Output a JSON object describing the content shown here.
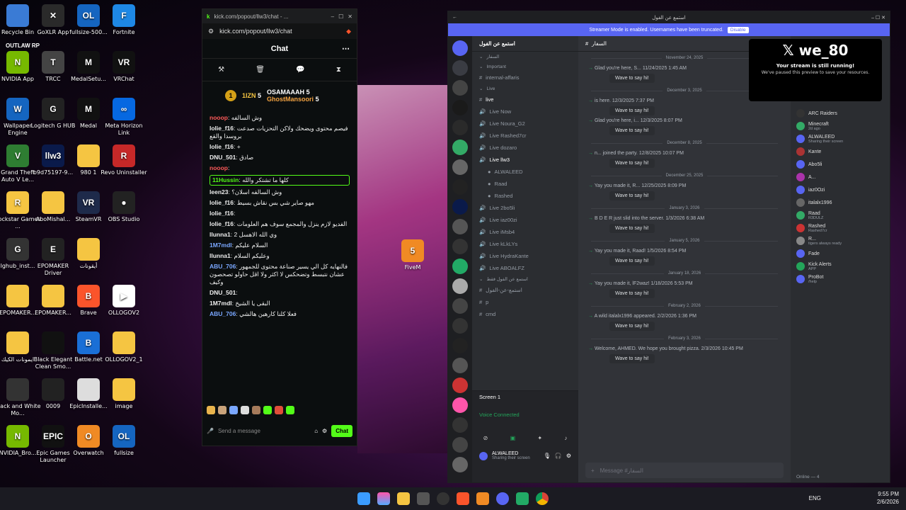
{
  "desktop": {
    "icons": [
      {
        "label": "Recycle Bin",
        "badge": ""
      },
      {
        "label": "GoXLR App",
        "badge": "✕"
      },
      {
        "label": "fullsize-500...",
        "badge": "OL"
      },
      {
        "label": "Fortnite",
        "badge": "F"
      },
      {
        "label": "NVIDIA App",
        "badge": "N"
      },
      {
        "label": "TRCC",
        "badge": "T"
      },
      {
        "label": "MedalSetu...",
        "badge": "M"
      },
      {
        "label": "VRChat",
        "badge": "VR"
      },
      {
        "label": "Wallpaper Engine",
        "badge": "W"
      },
      {
        "label": "Logitech G HUB",
        "badge": "G"
      },
      {
        "label": "Medal",
        "badge": "M"
      },
      {
        "label": "Meta Horizon Link",
        "badge": "∞"
      },
      {
        "label": "Grand Theft Auto V Le...",
        "badge": "V"
      },
      {
        "label": "b9d75197-9...",
        "badge": "llw3"
      },
      {
        "label": "980 1",
        "badge": ""
      },
      {
        "label": "Revo Uninstaller",
        "badge": "R"
      },
      {
        "label": "Rockstar Games ...",
        "badge": "R"
      },
      {
        "label": "AboMishal...",
        "badge": ""
      },
      {
        "label": "SteamVR",
        "badge": "VR"
      },
      {
        "label": "OBS Studio",
        "badge": "●"
      },
      {
        "label": "lghub_inst...",
        "badge": "G"
      },
      {
        "label": "EPOMAKER Driver",
        "badge": "E"
      },
      {
        "label": "أيقونات",
        "badge": ""
      },
      {
        "label": "EPOMAKER...",
        "badge": ""
      },
      {
        "label": "EPOMAKER...",
        "badge": ""
      },
      {
        "label": "Brave",
        "badge": "B"
      },
      {
        "label": "OLLOGOV2",
        "badge": "▶"
      },
      {
        "label": "ايمونات الكيك",
        "badge": ""
      },
      {
        "label": "Black Elegant Clean Smo...",
        "badge": ""
      },
      {
        "label": "Battle.net",
        "badge": "B"
      },
      {
        "label": "OLLOGOV2_1",
        "badge": ""
      },
      {
        "label": "Black and White Mo...",
        "badge": ""
      },
      {
        "label": "0009",
        "badge": ""
      },
      {
        "label": "EpicInstalle...",
        "badge": ""
      },
      {
        "label": "image",
        "badge": ""
      },
      {
        "label": "NVIDIA_Bro...",
        "badge": "N"
      },
      {
        "label": "Epic Games Launcher",
        "badge": "EPIC"
      },
      {
        "label": "Overwatch",
        "badge": "O"
      },
      {
        "label": "fullsize",
        "badge": "OL"
      },
      {
        "label": "FiveM",
        "badge": "5"
      }
    ],
    "outlaw_label": "OUTLAW RP"
  },
  "kick": {
    "title": "kick.com/popout/llw3/chat - ...",
    "url": "kick.com/popout/llw3/chat",
    "header": "Chat",
    "board": {
      "rank": "1",
      "n1": "1IZN",
      "p1": "5",
      "n2": "OSAMAAAH",
      "p2": "5",
      "n3": "GhostMansoori",
      "p3": "5"
    },
    "messages": [
      {
        "user": "nooop",
        "text": "وش السالفه",
        "color": "#ff5a5a"
      },
      {
        "user": "lolie_f16",
        "text": "فيصم محتوى ويضحك ولاكن التحزيات صدعت بروسدا والقع",
        "color": "#eee"
      },
      {
        "user": "lolie_f16",
        "text": "+",
        "color": "#eee"
      },
      {
        "user": "DNU_501",
        "text": "صادق",
        "color": "#eee"
      },
      {
        "user": "nooop",
        "text": "",
        "color": "#ff5a5a"
      },
      {
        "user": "11Hussin",
        "text": "كلها ما تشتكر والله",
        "color": "#53fc18"
      },
      {
        "user": "leen23",
        "text": "وش السالفه اسلان؟",
        "color": "#eee"
      },
      {
        "user": "lolie_f16",
        "text": "مهو صاير شي بس نقاش بسيط",
        "color": "#eee"
      },
      {
        "user": "lolie_f16",
        "text": "",
        "color": "#eee"
      },
      {
        "user": "lolie_f16",
        "text": "الفديو لازم ينزل والمجمع سوف هم العلومات",
        "color": "#eee"
      },
      {
        "user": "llunna1",
        "text": "وي الله الاهسل 2",
        "color": "#eee"
      },
      {
        "user": "1M7mdl",
        "text": "السلام عليكم",
        "color": "#7aa7ff"
      },
      {
        "user": "llunna1",
        "text": "وعليكم السلام",
        "color": "#eee"
      },
      {
        "user": "ABU_706",
        "text": "فالنهايه كل الي يسير صناعة محتوى للجمهور عشان نتبسط وتضحكس لا اكثر ولا اقل حاولو تصحصون وكيف",
        "color": "#7aa7ff"
      },
      {
        "user": "DNU_501",
        "text": "",
        "color": "#eee"
      },
      {
        "user": "1M7mdl",
        "text": "البقى يا الشيخ",
        "color": "#eee"
      },
      {
        "user": "ABU_706",
        "text": "فعلا كلنا كارهين هالشي",
        "color": "#7aa7ff"
      }
    ],
    "input_placeholder": "Send a message",
    "chat_button": "Chat"
  },
  "discord": {
    "title": "استمع عن الفول",
    "banner": "Streamer Mode is enabled. Usernames have been truncated.",
    "disable": "Disable",
    "server_name": "استمع عن الفول",
    "channel_header": "السفار",
    "channels": [
      {
        "name": "السفار",
        "type": "cat"
      },
      {
        "name": "Important",
        "type": "cat"
      },
      {
        "name": "internal-affaris",
        "type": "text"
      },
      {
        "name": "Live",
        "type": "cat"
      },
      {
        "name": "live",
        "type": "text"
      },
      {
        "name": "Live Now",
        "type": "voice"
      },
      {
        "name": "Live Noura_G2",
        "type": "voice"
      },
      {
        "name": "Live Rashed7cr",
        "type": "voice"
      },
      {
        "name": "Live dozaro",
        "type": "voice"
      },
      {
        "name": "Live llw3",
        "type": "voice"
      },
      {
        "name": "ALWALEED",
        "type": "user"
      },
      {
        "name": "Raad",
        "type": "user"
      },
      {
        "name": "Rashed",
        "type": "user"
      },
      {
        "name": "Live 2bo5li",
        "type": "voice"
      },
      {
        "name": "Live iaz00zi",
        "type": "voice"
      },
      {
        "name": "Live iMsb4",
        "type": "voice"
      },
      {
        "name": "Live kLkLYs",
        "type": "voice"
      },
      {
        "name": "Live HydraKante",
        "type": "voice"
      },
      {
        "name": "Live ABOALFZ",
        "type": "voice"
      },
      {
        "name": "استمع عن الفول فقط",
        "type": "cat"
      },
      {
        "name": "استمع-عن-الفول",
        "type": "text"
      },
      {
        "name": "p",
        "type": "text"
      },
      {
        "name": "cmd",
        "type": "text"
      }
    ],
    "screen": "Screen 1",
    "voice_connected": "Voice Connected",
    "user_name": "ALWALEED",
    "user_status": "Sharing their screen",
    "chat_items": [
      {
        "sep": "November 24, 2025",
        "msg": "Glad you're here, S... 11/24/2025 1:45 AM"
      },
      {
        "sep": "December 3, 2025",
        "msg": "is here. 12/3/2025 7:37 PM"
      },
      {
        "sep": "",
        "msg": "Glad you're here, i... 12/3/2025 8:07 PM"
      },
      {
        "sep": "December 8, 2025",
        "msg": "n... joined the party. 12/8/2025 10:07 PM"
      },
      {
        "sep": "December 25, 2025",
        "msg": "Yay you made it, R... 12/25/2025 8:09 PM"
      },
      {
        "sep": "January 3, 2026",
        "msg": "B D E R just slid into the server. 1/3/2026 6:38 AM"
      },
      {
        "sep": "January 5, 2026",
        "msg": "Yay you made it, Raad! 1/5/2026 8:54 PM"
      },
      {
        "sep": "January 18, 2026",
        "msg": "Yay you made it, lF2waz! 1/18/2026 5:53 PM"
      },
      {
        "sep": "February 2, 2026",
        "msg": "A wild italalx1996 appeared. 2/2/2026 1:36 PM"
      },
      {
        "sep": "February 3, 2026",
        "msg": "Welcome, AHMED. We hope you brought pizza. 2/3/2026 10:45 PM"
      }
    ],
    "wave": "Wave to say hi!",
    "message_placeholder": "Message #السفار",
    "members": [
      {
        "name": "ARC Raiders",
        "sub": ""
      },
      {
        "name": "Minecraft",
        "sub": "2d ago"
      },
      {
        "name": "ALWALEED",
        "sub": "Sharing their screen"
      },
      {
        "name": "Kante",
        "sub": ""
      },
      {
        "name": "Abo5li",
        "sub": ""
      },
      {
        "name": "A...",
        "sub": ""
      },
      {
        "name": "iaz0Ozi",
        "sub": ""
      },
      {
        "name": "italalx1996",
        "sub": ""
      },
      {
        "name": "Raad",
        "sub": "R3DULZ"
      },
      {
        "name": "Rashed",
        "sub": "Rashed7cr"
      },
      {
        "name": "R...",
        "sub": "tigers always ready"
      },
      {
        "name": "Fade",
        "sub": ""
      },
      {
        "name": "Kick Alerts",
        "sub": "APP"
      },
      {
        "name": "ProBot",
        "sub": "/help"
      }
    ],
    "online": "Online — 4"
  },
  "popup": {
    "brand": "we_80",
    "line1": "Your stream is still running!",
    "line2": "We've paused this preview to save your resources."
  },
  "tray": {
    "lang": "ENG",
    "time": "9:55 PM",
    "date": "2/6/2026"
  }
}
